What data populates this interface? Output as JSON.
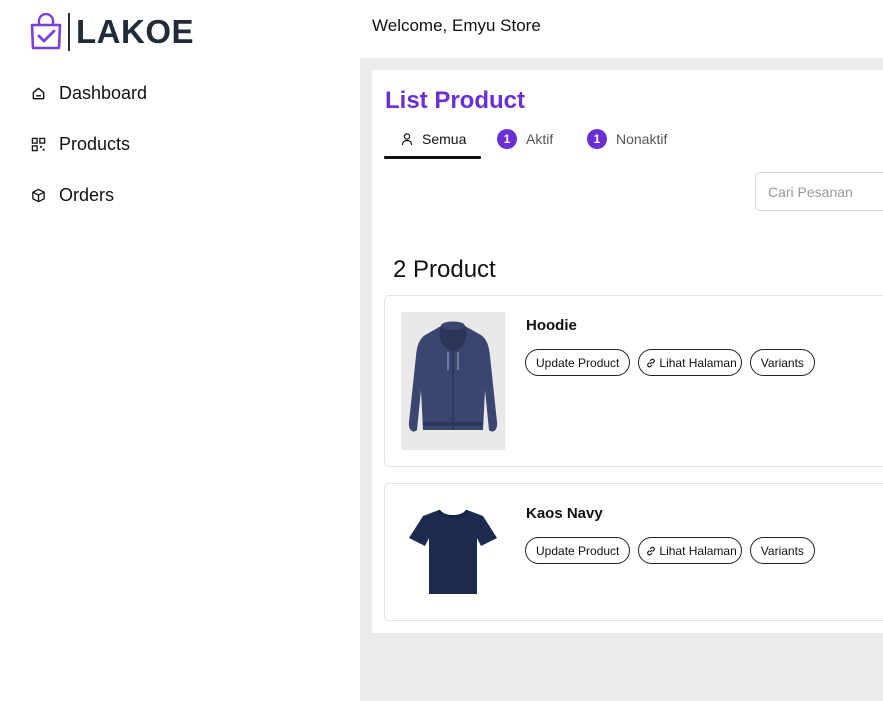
{
  "brand": {
    "name": "LAKOE",
    "color": "#6b2fd8"
  },
  "sidebar": {
    "items": [
      {
        "label": "Dashboard",
        "icon": "home-icon"
      },
      {
        "label": "Products",
        "icon": "grid-icon"
      },
      {
        "label": "Orders",
        "icon": "box-icon"
      }
    ]
  },
  "header": {
    "welcome": "Welcome, Emyu Store"
  },
  "page": {
    "title": "List Product",
    "tabs": [
      {
        "label": "Semua",
        "icon": "user-icon",
        "active": true
      },
      {
        "label": "Aktif",
        "badge": "1"
      },
      {
        "label": "Nonaktif",
        "badge": "1"
      }
    ],
    "search": {
      "placeholder": "Cari Pesanan",
      "value": ""
    },
    "count_label": "2 Product"
  },
  "products": [
    {
      "name": "Hoodie",
      "image": "navy-hoodie-image",
      "actions": {
        "update": "Update Product",
        "view": "Lihat Halaman",
        "variants": "Variants"
      }
    },
    {
      "name": "Kaos Navy",
      "image": "navy-tshirt-image",
      "actions": {
        "update": "Update Product",
        "view": "Lihat Halaman",
        "variants": "Variants"
      }
    }
  ]
}
